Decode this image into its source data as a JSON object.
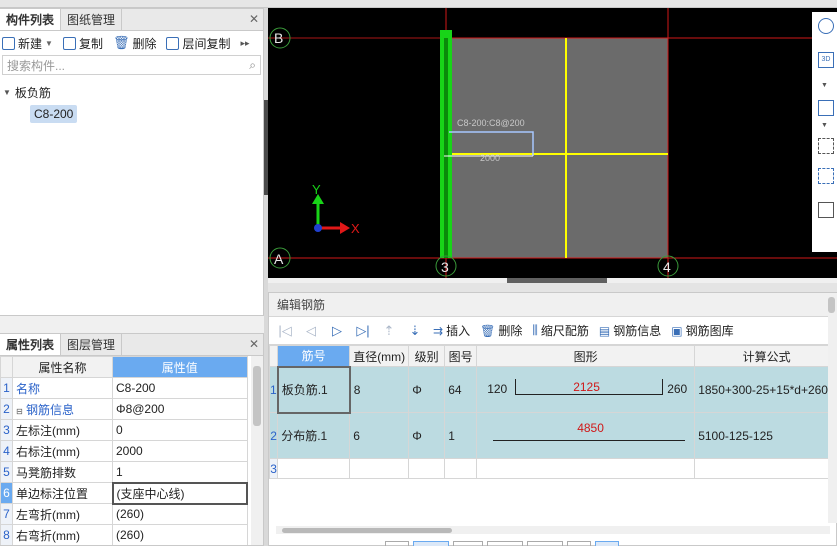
{
  "left_top_panel": {
    "tabs": [
      "构件列表",
      "图纸管理"
    ],
    "toolbar": {
      "new": "新建",
      "copy": "复制",
      "delete": "删除",
      "floor_copy": "层间复制"
    },
    "search_placeholder": "搜索构件...",
    "tree": {
      "group": "板负筋",
      "item": "C8-200"
    }
  },
  "properties_panel": {
    "tabs": [
      "属性列表",
      "图层管理"
    ],
    "headers": [
      "属性名称",
      "属性值"
    ],
    "rows": [
      {
        "n": "1",
        "name": "名称",
        "value": "C8-200"
      },
      {
        "n": "2",
        "name": "钢筋信息",
        "value": "Φ8@200"
      },
      {
        "n": "3",
        "name": "左标注(mm)",
        "value": "0"
      },
      {
        "n": "4",
        "name": "右标注(mm)",
        "value": "2000"
      },
      {
        "n": "5",
        "name": "马凳筋排数",
        "value": "1"
      },
      {
        "n": "6",
        "name": "单边标注位置",
        "value": "(支座中心线)"
      },
      {
        "n": "7",
        "name": "左弯折(mm)",
        "value": "(260)"
      },
      {
        "n": "8",
        "name": "右弯折(mm)",
        "value": "(260)"
      }
    ]
  },
  "canvas": {
    "axis_labels": {
      "B": "B",
      "A": "A",
      "c3": "3",
      "c4": "4"
    },
    "rebar_label": "C8-200:C8@200",
    "dim_label": "2000",
    "axis_y": "Y",
    "axis_x": "X",
    "colors": {
      "slab": "#6b6b6b",
      "grid": "#d01818",
      "highlight": "#18d418",
      "rebar_line": "#ffff00"
    }
  },
  "editor": {
    "title": "编辑钢筋",
    "toolbar": {
      "insert": "插入",
      "delete": "删除",
      "scale": "缩尺配筋",
      "info": "钢筋信息",
      "library": "钢筋图库"
    },
    "headers": [
      "筋号",
      "直径(mm)",
      "级别",
      "图号",
      "图形",
      "计算公式"
    ],
    "rows": [
      {
        "n": "1",
        "name": "板负筋.1",
        "dia": "8",
        "grade": "Φ",
        "fig": "64",
        "left": "120",
        "mid": "2125",
        "right": "260",
        "formula": "1850+300-25+15*d+260"
      },
      {
        "n": "2",
        "name": "分布筋.1",
        "dia": "6",
        "grade": "Φ",
        "fig": "1",
        "left": "",
        "mid": "4850",
        "right": "",
        "formula": "5100-125-125"
      },
      {
        "n": "3",
        "name": "",
        "dia": "",
        "grade": "",
        "fig": "",
        "left": "",
        "mid": "",
        "right": "",
        "formula": ""
      }
    ]
  }
}
